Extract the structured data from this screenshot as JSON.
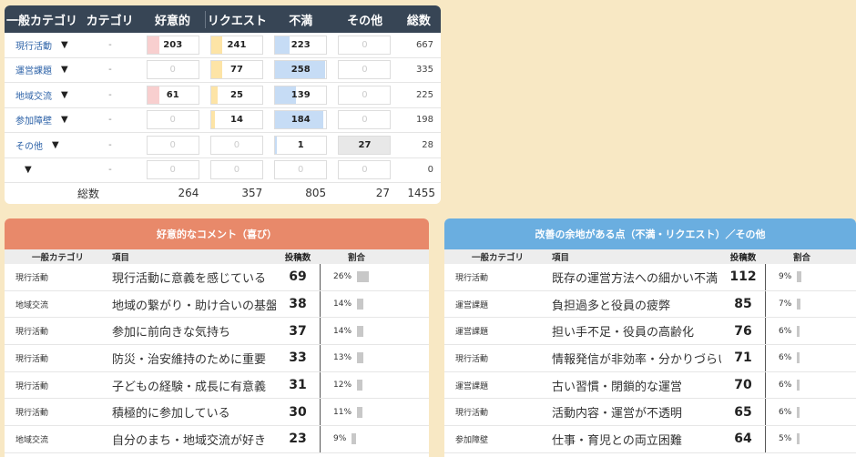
{
  "summary": {
    "headers": [
      "一般カテゴリ",
      "カテゴリ",
      "好意的",
      "リクエスト",
      "不満",
      "その他",
      "総数"
    ],
    "rows": [
      {
        "cat": "現行活動",
        "sub": "-",
        "fav": "203",
        "req": "241",
        "dis": "223",
        "oth": "0",
        "total": "667",
        "fav_pct": 0.23,
        "req_pct": 0.22,
        "dis_pct": 0.28,
        "oth_pct": 0
      },
      {
        "cat": "運営課題",
        "sub": "-",
        "fav": "0",
        "req": "77",
        "dis": "258",
        "oth": "0",
        "total": "335",
        "fav_pct": 0,
        "req_pct": 0.22,
        "dis_pct": 0.98,
        "oth_pct": 0
      },
      {
        "cat": "地域交流",
        "sub": "-",
        "fav": "61",
        "req": "25",
        "dis": "139",
        "oth": "0",
        "total": "225",
        "fav_pct": 0.23,
        "req_pct": 0.12,
        "dis_pct": 0.4,
        "oth_pct": 0
      },
      {
        "cat": "参加障壁",
        "sub": "-",
        "fav": "0",
        "req": "14",
        "dis": "184",
        "oth": "0",
        "total": "198",
        "fav_pct": 0,
        "req_pct": 0.08,
        "dis_pct": 0.95,
        "oth_pct": 0
      },
      {
        "cat": "その他",
        "sub": "-",
        "fav": "0",
        "req": "0",
        "dis": "1",
        "oth": "27",
        "total": "28",
        "fav_pct": 0,
        "req_pct": 0,
        "dis_pct": 0.04,
        "oth_pct": 1
      },
      {
        "cat": "",
        "sub": "-",
        "fav": "0",
        "req": "0",
        "dis": "0",
        "oth": "0",
        "total": "0",
        "fav_pct": 0,
        "req_pct": 0,
        "dis_pct": 0,
        "oth_pct": 0
      }
    ],
    "sum_label": "総数",
    "sums": {
      "fav": "264",
      "req": "357",
      "dis": "805",
      "oth": "27",
      "total": "1455"
    },
    "colors": {
      "fav": "#f8cfcf",
      "req": "#fde4a6",
      "dis": "#c6dcf5",
      "oth": "#e8e8e8"
    }
  },
  "positive": {
    "title": "好意的なコメント（喜び）",
    "headers": {
      "cat": "一般カテゴリ",
      "item": "項目",
      "count": "投稿数",
      "ratio": "割合"
    },
    "rows": [
      {
        "cat": "現行活動",
        "item": "現行活動に意義を感じている",
        "count": "69",
        "ratio": "26%",
        "pct": 26
      },
      {
        "cat": "地域交流",
        "item": "地域の繋がり・助け合いの基盤",
        "count": "38",
        "ratio": "14%",
        "pct": 14
      },
      {
        "cat": "現行活動",
        "item": "参加に前向きな気持ち",
        "count": "37",
        "ratio": "14%",
        "pct": 14
      },
      {
        "cat": "現行活動",
        "item": "防災・治安維持のために重要",
        "count": "33",
        "ratio": "13%",
        "pct": 13
      },
      {
        "cat": "現行活動",
        "item": "子どもの経験・成長に有意義",
        "count": "31",
        "ratio": "12%",
        "pct": 12
      },
      {
        "cat": "現行活動",
        "item": "積極的に参加している",
        "count": "30",
        "ratio": "11%",
        "pct": 11
      },
      {
        "cat": "地域交流",
        "item": "自分のまち・地域交流が好き",
        "count": "23",
        "ratio": "9%",
        "pct": 9
      }
    ]
  },
  "improve": {
    "title": "改善の余地がある点（不満・リクエスト）／その他",
    "headers": {
      "cat": "一般カテゴリ",
      "item": "項目",
      "count": "投稿数",
      "ratio": "割合"
    },
    "rows": [
      {
        "cat": "現行活動",
        "item": "既存の運営方法への細かい不満",
        "count": "112",
        "ratio": "9%",
        "pct": 9
      },
      {
        "cat": "運営課題",
        "item": "負担過多と役員の疲弊",
        "count": "85",
        "ratio": "7%",
        "pct": 7
      },
      {
        "cat": "運営課題",
        "item": "担い手不足・役員の高齢化",
        "count": "76",
        "ratio": "6%",
        "pct": 6
      },
      {
        "cat": "現行活動",
        "item": "情報発信が非効率・分かりづらい",
        "count": "71",
        "ratio": "6%",
        "pct": 6
      },
      {
        "cat": "運営課題",
        "item": "古い習慣・閉鎖的な運営",
        "count": "70",
        "ratio": "6%",
        "pct": 6
      },
      {
        "cat": "現行活動",
        "item": "活動内容・運営が不透明",
        "count": "65",
        "ratio": "6%",
        "pct": 6
      },
      {
        "cat": "参加障壁",
        "item": "仕事・育児との両立困難",
        "count": "64",
        "ratio": "5%",
        "pct": 5
      }
    ]
  }
}
